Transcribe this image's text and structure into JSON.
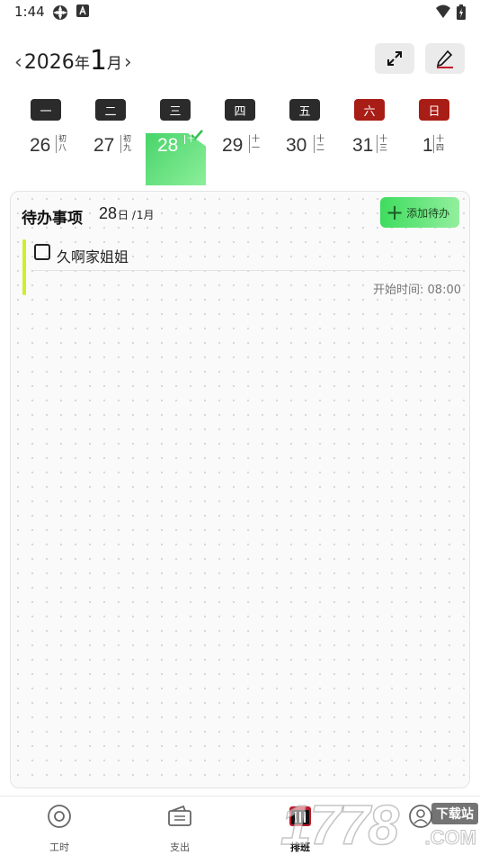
{
  "status_bar": {
    "time": "1:44",
    "icons": [
      "network-icon",
      "a-icon",
      "wifi-icon",
      "battery-icon"
    ]
  },
  "calendar_header": {
    "prev_icon": "chevron-left-icon",
    "year": "2026",
    "year_suffix": "年",
    "month": "1",
    "month_suffix": "月",
    "next_icon": "chevron-right-icon",
    "expand_icon": "expand-icon",
    "edit_icon": "pencil-icon"
  },
  "week": {
    "days": [
      {
        "weekday": "一",
        "date": "26",
        "lunar": "初八",
        "weekend": false,
        "selected": false
      },
      {
        "weekday": "二",
        "date": "27",
        "lunar": "初九",
        "weekend": false,
        "selected": false
      },
      {
        "weekday": "三",
        "date": "28",
        "lunar": "十",
        "weekend": false,
        "selected": true
      },
      {
        "weekday": "四",
        "date": "29",
        "lunar": "十一",
        "weekend": false,
        "selected": false
      },
      {
        "weekday": "五",
        "date": "30",
        "lunar": "十二",
        "weekend": false,
        "selected": false
      },
      {
        "weekday": "六",
        "date": "31",
        "lunar": "十三",
        "weekend": true,
        "selected": false
      },
      {
        "weekday": "日",
        "date": "1",
        "lunar": "十四",
        "weekend": true,
        "selected": false
      }
    ],
    "weekday_color": "#2b2b2b",
    "weekend_color": "#a81d16",
    "selected_gradient": [
      "#48d46a",
      "#8cef9a"
    ]
  },
  "todo": {
    "title": "待办事项",
    "date_day": "28",
    "date_sep": "日 /",
    "date_month": "1月",
    "add_label": "添加待办",
    "add_icon": "plus-icon",
    "items": [
      {
        "text": "久啊家姐姐",
        "checked": false,
        "start_time": "开始时间: 08:00",
        "color": "#cdef2d"
      }
    ]
  },
  "bottom_nav": {
    "items": [
      {
        "label": "工时",
        "icon": "clock-circle-icon",
        "active": false
      },
      {
        "label": "支出",
        "icon": "wallet-icon",
        "active": false
      },
      {
        "label": "排班",
        "icon": "schedule-icon",
        "active": true
      },
      {
        "label": "",
        "icon": "user-icon",
        "active": false
      }
    ]
  },
  "watermark": {
    "text": "1778",
    "badge": "下载站",
    "domain": ".COM"
  }
}
